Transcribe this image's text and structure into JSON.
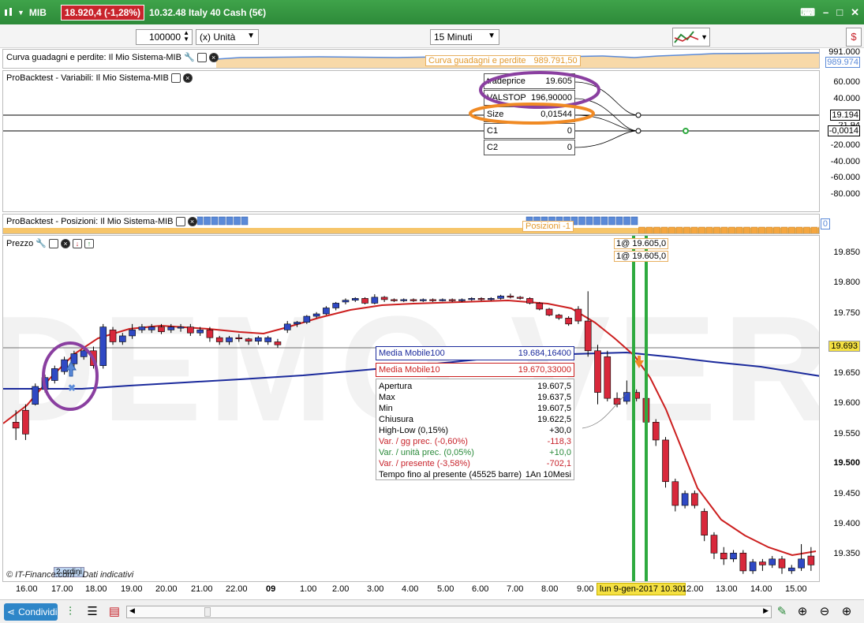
{
  "titlebar": {
    "symbol": "MIB",
    "price_badge": "18.920,4 (-1,28%)",
    "info": "10.32.48 Italy 40 Cash (5€)"
  },
  "toolbar": {
    "quantity": "100000",
    "unit": "(x) Unità",
    "timeframe": "15 Minuti"
  },
  "equity_panel": {
    "label": "Curva guadagni e perdite: Il Mio Sistema-MIB",
    "tooltip_label": "Curva guadagni e perdite",
    "tooltip_value": "989.791,50",
    "axis_top": "991.000",
    "axis_current": "989.974"
  },
  "variables_panel": {
    "label": "ProBacktest - Variabili: Il Mio Sistema-MIB",
    "vars": [
      {
        "name": "tradeprice",
        "value": "19.605"
      },
      {
        "name": "VALSTOP",
        "value": "196,90000"
      },
      {
        "name": "Size",
        "value": "0,01544"
      },
      {
        "name": "C1",
        "value": "0"
      },
      {
        "name": "C2",
        "value": "0"
      }
    ],
    "axis": [
      "60.000",
      "40.000",
      "19.194",
      "-0,0014",
      "-20.000",
      "-40.000",
      "-60.000",
      "-80.000"
    ],
    "axis_partial": "21,94"
  },
  "positions_panel": {
    "label": "ProBacktest - Posizioni: Il Mio Sistema-MIB",
    "tooltip": "Posizioni -1",
    "axis_value": "0"
  },
  "price_panel": {
    "label": "Prezzo",
    "order_labels": [
      "1@ 19.605,0",
      "1@ 19.605,0"
    ],
    "axis": [
      "19.850",
      "19.800",
      "19.750",
      "19.650",
      "19.600",
      "19.550",
      "19.500",
      "19.450",
      "19.400",
      "19.350"
    ],
    "current_price": "19.693",
    "ma100_label": "Media Mobile100",
    "ma100_value": "19.684,16400",
    "ma10_label": "Media Mobile10",
    "ma10_value": "19.670,33000",
    "info_rows": [
      {
        "label": "Apertura",
        "value": "19.607,5"
      },
      {
        "label": "Max",
        "value": "19.637,5"
      },
      {
        "label": "Min",
        "value": "19.607,5"
      },
      {
        "label": "Chiusura",
        "value": "19.622,5"
      },
      {
        "label": "High-Low (0,15%)",
        "value": "+30,0"
      },
      {
        "label": "Var. / gg prec. (-0,60%)",
        "value": "-118,3"
      },
      {
        "label": "Var. / unità prec. (0,05%)",
        "value": "+10,0"
      },
      {
        "label": "Var. / presente (-3,58%)",
        "value": "-702,1"
      },
      {
        "label": "Tempo fino al presente (45525 barre)",
        "value": "1An 10Mesi"
      }
    ],
    "copyright": "© IT-Finance.com - Dati indicativi",
    "small_tag": "2 ordini",
    "watermark": "DEMO VERSION"
  },
  "xaxis": {
    "labels": [
      "16.00",
      "17.00",
      "18.00",
      "19.00",
      "20.00",
      "21.00",
      "22.00",
      "09",
      "1.00",
      "2.00",
      "3.00",
      "4.00",
      "5.00",
      "6.00",
      "7.00",
      "8.00",
      "9.00",
      "12.00",
      "13.00",
      "14.00",
      "15.00"
    ],
    "highlight": "lun 9-gen-2017 10.30"
  },
  "bottombar": {
    "share_label": "Condividi"
  },
  "colors": {
    "bull": "#2f49c4",
    "bear": "#d8283b",
    "ma10": "#cc1f1f",
    "ma100": "#1b2a9c",
    "highlight": "#2eaa3f"
  },
  "chart_data": {
    "type": "candlestick",
    "ylim": [
      19300,
      19870
    ],
    "candles": [
      [
        19570,
        19560,
        19590,
        19540
      ],
      [
        19590,
        19550,
        19600,
        19540
      ],
      [
        19600,
        19630,
        19635,
        19598
      ],
      [
        19625,
        19645,
        19650,
        19620
      ],
      [
        19640,
        19660,
        19665,
        19635
      ],
      [
        19655,
        19675,
        19680,
        19650
      ],
      [
        19668,
        19685,
        19690,
        19660
      ],
      [
        19680,
        19690,
        19695,
        19675
      ],
      [
        19690,
        19665,
        19697,
        19660
      ],
      [
        19665,
        19730,
        19735,
        19660
      ],
      [
        19725,
        19705,
        19730,
        19700
      ],
      [
        19705,
        19715,
        19720,
        19700
      ],
      [
        19715,
        19725,
        19735,
        19710
      ],
      [
        19725,
        19730,
        19735,
        19720
      ],
      [
        19725,
        19730,
        19735,
        19720
      ],
      [
        19730,
        19722,
        19735,
        19718
      ],
      [
        19725,
        19730,
        19735,
        19720
      ],
      [
        19728,
        19730,
        19735,
        19722
      ],
      [
        19730,
        19720,
        19735,
        19715
      ],
      [
        19720,
        19725,
        19730,
        19715
      ],
      [
        19725,
        19712,
        19730,
        19705
      ],
      [
        19712,
        19705,
        19715,
        19700
      ],
      [
        19705,
        19712,
        19715,
        19700
      ],
      [
        19712,
        19710,
        19718,
        19705
      ],
      [
        19710,
        19706,
        19712,
        19700
      ],
      [
        19706,
        19712,
        19715,
        19700
      ],
      [
        19705,
        19712,
        19715,
        19700
      ],
      [
        19705,
        19700,
        19710,
        19695
      ],
      [
        19725,
        19735,
        19740,
        19720
      ],
      [
        19735,
        19738,
        19740,
        19730
      ],
      [
        19738,
        19748,
        19750,
        19735
      ],
      [
        19748,
        19752,
        19755,
        19745
      ],
      [
        19752,
        19762,
        19765,
        19750
      ],
      [
        19762,
        19770,
        19772,
        19758
      ],
      [
        19772,
        19775,
        19778,
        19768
      ],
      [
        19775,
        19778,
        19780,
        19772
      ],
      [
        19778,
        19770,
        19780,
        19768
      ],
      [
        19770,
        19780,
        19785,
        19768
      ],
      [
        19780,
        19776,
        19782,
        19772
      ],
      [
        19776,
        19774,
        19778,
        19772
      ],
      [
        19774,
        19776,
        19778,
        19772
      ],
      [
        19776,
        19774,
        19778,
        19772
      ],
      [
        19774,
        19776,
        19778,
        19772
      ],
      [
        19776,
        19775,
        19778,
        19772
      ],
      [
        19775,
        19776,
        19778,
        19773
      ],
      [
        19776,
        19774,
        19778,
        19772
      ],
      [
        19774,
        19776,
        19778,
        19772
      ],
      [
        19776,
        19778,
        19780,
        19774
      ],
      [
        19778,
        19776,
        19780,
        19774
      ],
      [
        19776,
        19778,
        19780,
        19774
      ],
      [
        19778,
        19782,
        19784,
        19776
      ],
      [
        19782,
        19780,
        19786,
        19778
      ],
      [
        19780,
        19778,
        19782,
        19776
      ],
      [
        19778,
        19770,
        19780,
        19768
      ],
      [
        19770,
        19760,
        19772,
        19758
      ],
      [
        19760,
        19750,
        19762,
        19748
      ],
      [
        19750,
        19745,
        19752,
        19742
      ],
      [
        19745,
        19735,
        19748,
        19732
      ],
      [
        19760,
        19740,
        19765,
        19735
      ],
      [
        19740,
        19690,
        19790,
        19680
      ],
      [
        19690,
        19620,
        19700,
        19600
      ],
      [
        19680,
        19610,
        19690,
        19605
      ],
      [
        19610,
        19600,
        19620,
        19595
      ],
      [
        19605,
        19620,
        19640,
        19600
      ],
      [
        19620,
        19610,
        19625,
        19605
      ],
      [
        19610,
        19570,
        19615,
        19560
      ],
      [
        19570,
        19540,
        19575,
        19530
      ],
      [
        19540,
        19470,
        19545,
        19460
      ],
      [
        19470,
        19430,
        19475,
        19420
      ],
      [
        19430,
        19450,
        19455,
        19425
      ],
      [
        19450,
        19430,
        19455,
        19425
      ],
      [
        19420,
        19380,
        19425,
        19370
      ],
      [
        19380,
        19350,
        19385,
        19340
      ],
      [
        19350,
        19340,
        19360,
        19330
      ],
      [
        19340,
        19350,
        19355,
        19335
      ],
      [
        19350,
        19320,
        19355,
        19315
      ],
      [
        19320,
        19335,
        19340,
        19315
      ],
      [
        19335,
        19330,
        19340,
        19320
      ],
      [
        19330,
        19340,
        19345,
        19325
      ],
      [
        19340,
        19325,
        19345,
        19315
      ],
      [
        19320,
        19325,
        19330,
        19315
      ],
      [
        19325,
        19340,
        19365,
        19320
      ],
      [
        19345,
        19330,
        19360,
        19320
      ]
    ]
  }
}
